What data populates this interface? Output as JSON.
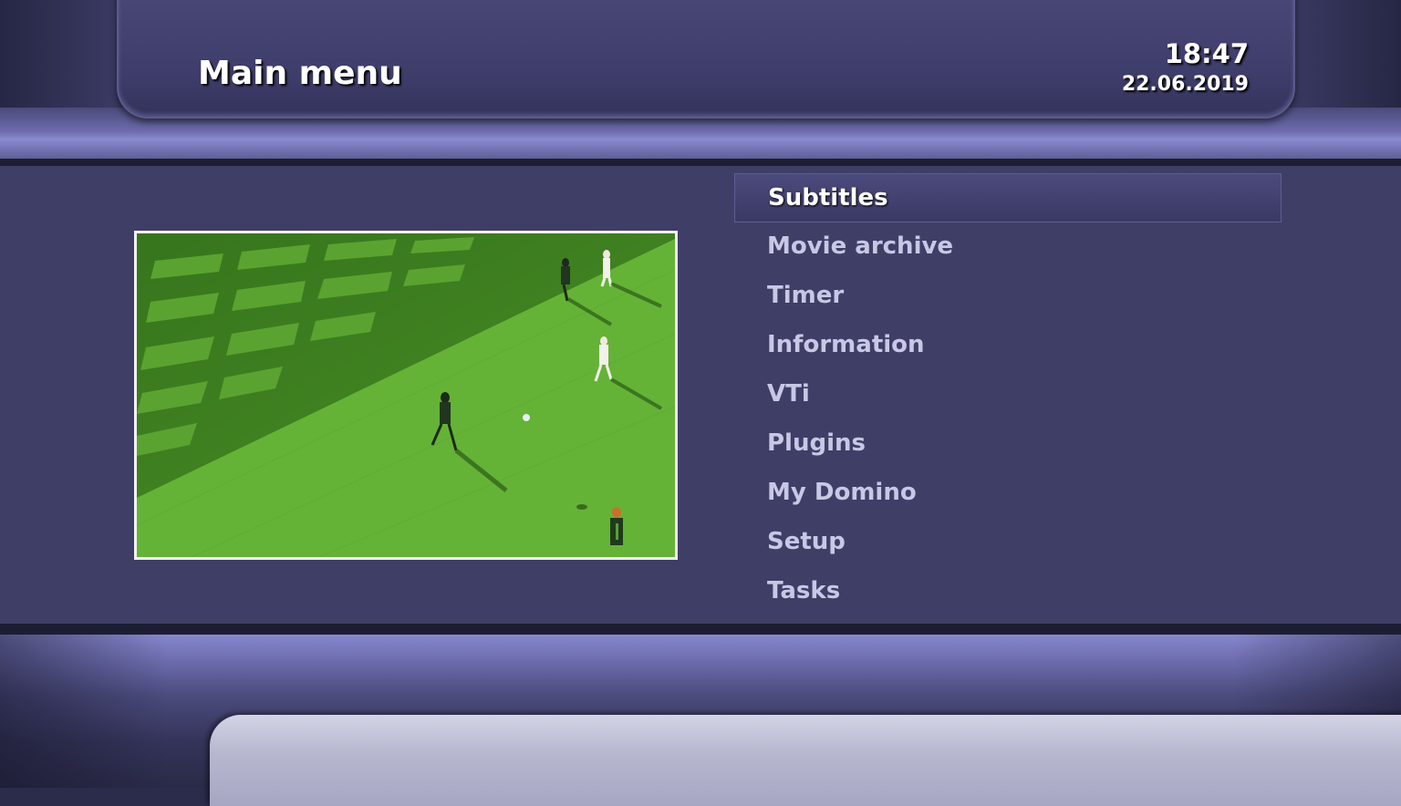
{
  "header": {
    "title": "Main menu",
    "time": "18:47",
    "date": "22.06.2019"
  },
  "preview": {
    "content": "live TV preview: football match"
  },
  "menu": {
    "selected_index": 0,
    "items": [
      {
        "label": "Subtitles"
      },
      {
        "label": "Movie archive"
      },
      {
        "label": "Timer"
      },
      {
        "label": "Information"
      },
      {
        "label": "VTi"
      },
      {
        "label": "Plugins"
      },
      {
        "label": "My Domino"
      },
      {
        "label": "Setup"
      },
      {
        "label": "Tasks"
      }
    ]
  },
  "colors": {
    "background": "#3f3e66",
    "highlight": "#4b4a7c",
    "text_selected": "#ffffff",
    "text_normal": "#c8c8e6",
    "pitch_green": "#62b134"
  }
}
